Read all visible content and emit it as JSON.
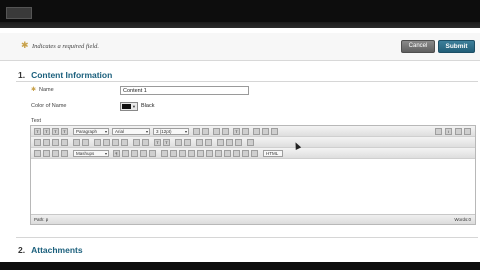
{
  "required_bar": {
    "star": "✱",
    "text": "Indicates a required field."
  },
  "buttons": {
    "cancel": "Cancel",
    "submit": "Submit"
  },
  "section1": {
    "number": "1.",
    "title": "Content Information"
  },
  "fields": {
    "name_label": "Name",
    "name_value": "Content 1",
    "color_label": "Color of Name",
    "color_value": "Black",
    "text_label": "Text"
  },
  "editor": {
    "paragraph": "Paragraph",
    "font": "Arial",
    "size": "3 (12pt)",
    "mashups": "Mashups",
    "html_button": "HTML",
    "status_path": "Path: p",
    "word_count": "Words:0"
  },
  "section2": {
    "number": "2.",
    "title": "Attachments"
  },
  "colors": {
    "accent": "#1a5f7c",
    "submit": "#225e78",
    "required": "#c8a14a"
  }
}
